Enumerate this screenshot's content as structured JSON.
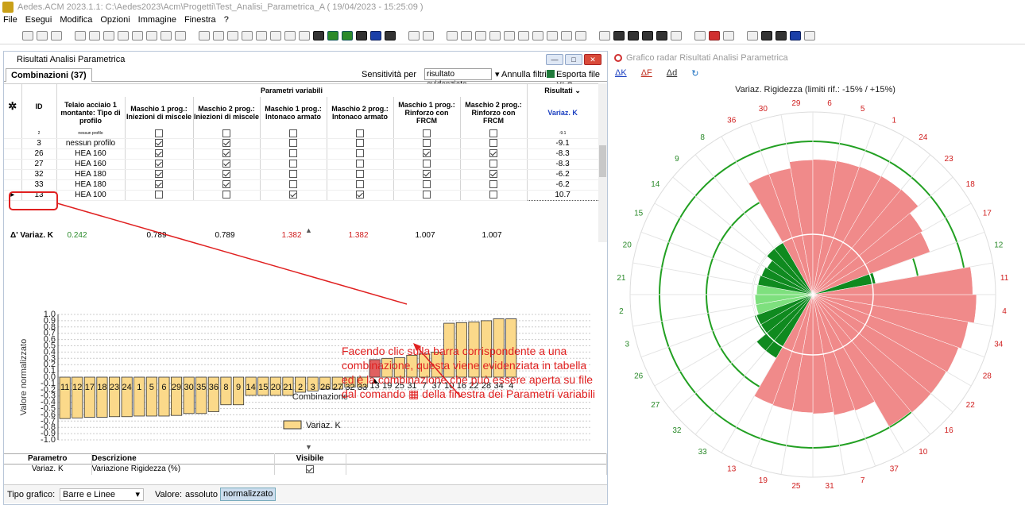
{
  "app": {
    "title": "Aedes.ACM 2023.1.1: C:\\Aedes2023\\Acm\\Progetti\\Test_Analisi_Parametrica_A  ( 19/04/2023 - 15:25:09 )"
  },
  "menu": [
    "File",
    "Esegui",
    "Modifica",
    "Opzioni",
    "Immagine",
    "Finestra",
    "?"
  ],
  "left": {
    "title": "Risultati Analisi Parametrica",
    "tab": "Combinazioni (37)",
    "sensitivity_label": "Sensitività per",
    "sensitivity_value": "risultato evidenziato",
    "annulla": "Annulla filtri",
    "esporta": "Esporta file XLS",
    "group_header": "Parametri variabili",
    "results_header": "Risultati",
    "columns": [
      "ID",
      "Telaio acciaio 1 montante: Tipo di profilo",
      "Maschio 1 prog.: Iniezioni di miscele",
      "Maschio 2 prog.: Iniezioni di miscele",
      "Maschio 1 prog.: Intonaco armato",
      "Maschio 2 prog.: Intonaco armato",
      "Maschio 1 prog.: Rinforzo con FRCM",
      "Maschio 2 prog.: Rinforzo con FRCM",
      "Variaz. K"
    ],
    "rows": [
      {
        "id": "2",
        "profile": "nessun profilo",
        "c": [
          false,
          false,
          false,
          false,
          false,
          false
        ],
        "k": "-9.1"
      },
      {
        "id": "3",
        "profile": "nessun profilo",
        "c": [
          true,
          true,
          false,
          false,
          false,
          false
        ],
        "k": "-9.1"
      },
      {
        "id": "26",
        "profile": "HEA 160",
        "c": [
          true,
          true,
          false,
          false,
          true,
          true
        ],
        "k": "-8.3"
      },
      {
        "id": "27",
        "profile": "HEA 160",
        "c": [
          true,
          true,
          false,
          false,
          false,
          false
        ],
        "k": "-8.3"
      },
      {
        "id": "32",
        "profile": "HEA 180",
        "c": [
          true,
          true,
          false,
          false,
          true,
          true
        ],
        "k": "-6.2"
      },
      {
        "id": "33",
        "profile": "HEA 180",
        "c": [
          true,
          true,
          false,
          false,
          false,
          false
        ],
        "k": "-6.2"
      },
      {
        "id": "13",
        "profile": "HEA 100",
        "c": [
          false,
          false,
          true,
          true,
          false,
          false
        ],
        "k": "10.7"
      }
    ],
    "summary": {
      "label": "Δ' Variaz. K",
      "values": [
        "0.242",
        "0.789",
        "0.789",
        "1.382",
        "1.382",
        "1.007",
        "1.007"
      ]
    },
    "params_table": {
      "headers": [
        "Parametro",
        "Descrizione",
        "Visibile"
      ],
      "row": {
        "param": "Variaz. K",
        "desc": "Variazione Rigidezza (%)"
      }
    },
    "footer": {
      "tipo_label": "Tipo grafico:",
      "tipo_value": "Barre e Linee",
      "valore_label": "Valore:",
      "assoluto": "assoluto",
      "normalizzato": "normalizzato"
    },
    "callout": "Facendo clic sulla barra corrispondente a una combinazione, questa viene evidenziata in tabella ed è la combinazione che può essere aperta su file dal comando ▦ della finestra dei Parametri variabili"
  },
  "chart_data": [
    {
      "type": "bar",
      "xlabel": "Combinazione",
      "ylabel": "Valore normalizzato",
      "ylim": [
        -1,
        1
      ],
      "yticks": [
        "1.0",
        "0.9",
        "0.8",
        "0.7",
        "0.6",
        "0.5",
        "0.4",
        "0.3",
        "0.2",
        "0.1",
        "0.0",
        "-0.1",
        "-0.2",
        "-0.3",
        "-0.4",
        "-0.5",
        "-0.6",
        "-0.7",
        "-0.8",
        "-0.9",
        "-1.0"
      ],
      "categories": [
        "11",
        "12",
        "17",
        "18",
        "23",
        "24",
        "1",
        "5",
        "6",
        "29",
        "30",
        "35",
        "36",
        "8",
        "9",
        "14",
        "15",
        "20",
        "21",
        "2",
        "3",
        "26",
        "27",
        "32",
        "33",
        "13",
        "19",
        "25",
        "31",
        "7",
        "37",
        "10",
        "16",
        "22",
        "28",
        "34",
        "4"
      ],
      "values": [
        -0.66,
        -0.65,
        -0.64,
        -0.64,
        -0.63,
        -0.63,
        -0.62,
        -0.62,
        -0.62,
        -0.61,
        -0.58,
        -0.58,
        -0.55,
        -0.44,
        -0.44,
        -0.29,
        -0.29,
        -0.29,
        -0.29,
        -0.24,
        -0.22,
        -0.19,
        -0.19,
        -0.16,
        -0.16,
        0.28,
        0.3,
        0.31,
        0.35,
        0.37,
        0.4,
        0.86,
        0.87,
        0.88,
        0.9,
        0.93,
        0.93
      ],
      "highlight": "13",
      "series_name": "Variaz. K",
      "bar_color": "#fbd98a",
      "highlight_color": "#e06060"
    },
    {
      "type": "radar",
      "title": "Variaz. Rigidezza (limiti rif.: -15% / +15%)",
      "order": [
        "4",
        "34",
        "28",
        "22",
        "16",
        "10",
        "37",
        "7",
        "31",
        "25",
        "19",
        "13",
        "33",
        "32",
        "27",
        "26",
        "3",
        "2",
        "21",
        "20",
        "15",
        "14",
        "9",
        "8",
        "36",
        "30",
        "29",
        "6",
        "5",
        "1",
        "24",
        "23",
        "18",
        "17",
        "12",
        "11"
      ],
      "values": [
        10.7,
        9.6,
        9.1,
        8.9,
        8.9,
        8.6,
        3.2,
        3.0,
        2.4,
        2.2,
        2.1,
        2.0,
        -6.2,
        -6.2,
        -8.3,
        -8.3,
        -9.1,
        -9.1,
        -9.4,
        -9.5,
        -9.7,
        -10.0,
        -8.7,
        -8.7,
        4.1,
        4.1,
        5.3,
        5.4,
        5.5,
        5.6,
        5.7,
        5.8,
        3.8,
        3.4,
        -8.0,
        10.0
      ],
      "legend": [
        "ΔK",
        "ΔF",
        "Δd"
      ]
    }
  ],
  "right": {
    "title": "Grafico radar Risultati Analisi Parametrica"
  },
  "colors": {
    "green": "#0f8a1f",
    "light_green": "#7ee07e",
    "pink": "#f08a8a",
    "bar": "#fbd98a",
    "red_callout": "#e02020"
  }
}
